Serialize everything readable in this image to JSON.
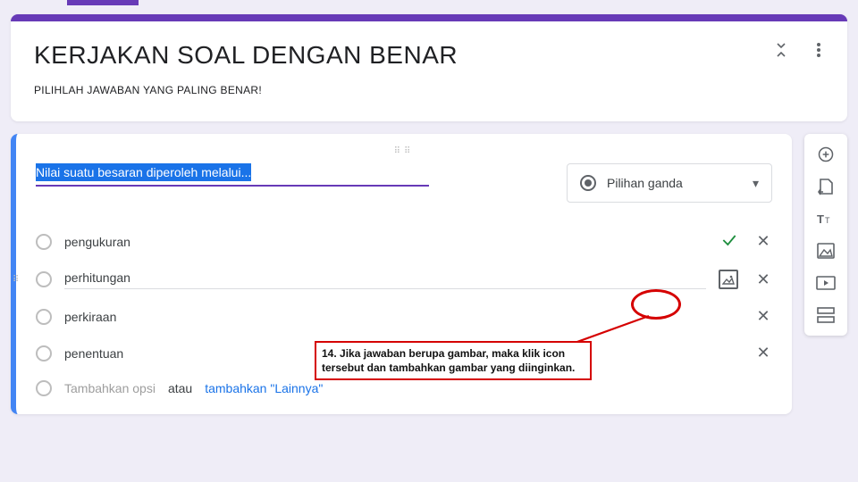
{
  "header": {
    "title": "KERJAKAN SOAL DENGAN BENAR",
    "subtitle": "PILIHLAH JAWABAN YANG PALING BENAR!"
  },
  "question": {
    "title_selected": "Nilai suatu besaran diperoleh melalui...",
    "type_label": "Pilihan ganda",
    "options": [
      {
        "label": "pengukuran",
        "correct": true,
        "active": false
      },
      {
        "label": "perhitungan",
        "correct": false,
        "active": true
      },
      {
        "label": "perkiraan",
        "correct": false,
        "active": false
      },
      {
        "label": "penentuan",
        "correct": false,
        "active": false
      }
    ],
    "add_option": "Tambahkan opsi",
    "or_text": " atau ",
    "add_other": "tambahkan \"Lainnya\""
  },
  "annotation": {
    "line1": "14. Jika jawaban berupa gambar, maka klik icon",
    "line2": "tersebut dan tambahkan gambar yang diinginkan."
  }
}
